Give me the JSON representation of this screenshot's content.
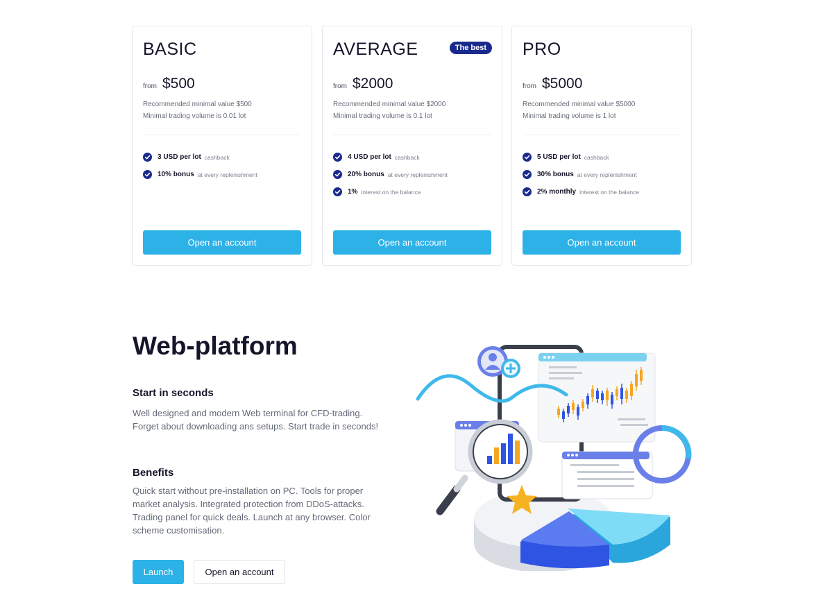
{
  "plans": [
    {
      "name": "BASIC",
      "badge": "",
      "from": "from",
      "price": "$500",
      "desc1": "Recommended minimal value $500",
      "desc2": "Minimal trading volume is 0.01 lot",
      "features": [
        {
          "strong": "3 USD per lot",
          "note": "cashback"
        },
        {
          "strong": "10% bonus",
          "note": "at every replenishment"
        }
      ],
      "button": "Open an account"
    },
    {
      "name": "AVERAGE",
      "badge": "The best",
      "from": "from",
      "price": "$2000",
      "desc1": "Recommended minimal value $2000",
      "desc2": "Minimal trading volume is 0.1 lot",
      "features": [
        {
          "strong": "4 USD per lot",
          "note": "cashback"
        },
        {
          "strong": "20% bonus",
          "note": "at every replenishment"
        },
        {
          "strong": "1%",
          "note": "interest on the balance"
        }
      ],
      "button": "Open an account"
    },
    {
      "name": "PRO",
      "badge": "",
      "from": "from",
      "price": "$5000",
      "desc1": "Recommended minimal value $5000",
      "desc2": "Minimal trading volume is 1 lot",
      "features": [
        {
          "strong": "5 USD per lot",
          "note": "cashback"
        },
        {
          "strong": "30% bonus",
          "note": "at every replenishment"
        },
        {
          "strong": "2% monthly",
          "note": "interest on the balance"
        }
      ],
      "button": "Open an account"
    }
  ],
  "webplatform": {
    "title": "Web-platform",
    "section1_heading": "Start in seconds",
    "section1_text": "Well designed and modern Web terminal for CFD-trading. Forget about downloading ans setups. Start trade in seconds!",
    "section2_heading": "Benefits",
    "section2_text": "Quick start without pre-installation on PC. Tools for proper market analysis. Integrated protection from DDoS-attacks. Trading panel for quick deals. Launch at any browser. Color scheme customisation.",
    "launch_label": "Launch",
    "open_label": "Open an account"
  },
  "colors": {
    "accent": "#2db2e8",
    "badge": "#1a2a8c",
    "text_dark": "#15152a",
    "text_muted": "#646a77"
  }
}
